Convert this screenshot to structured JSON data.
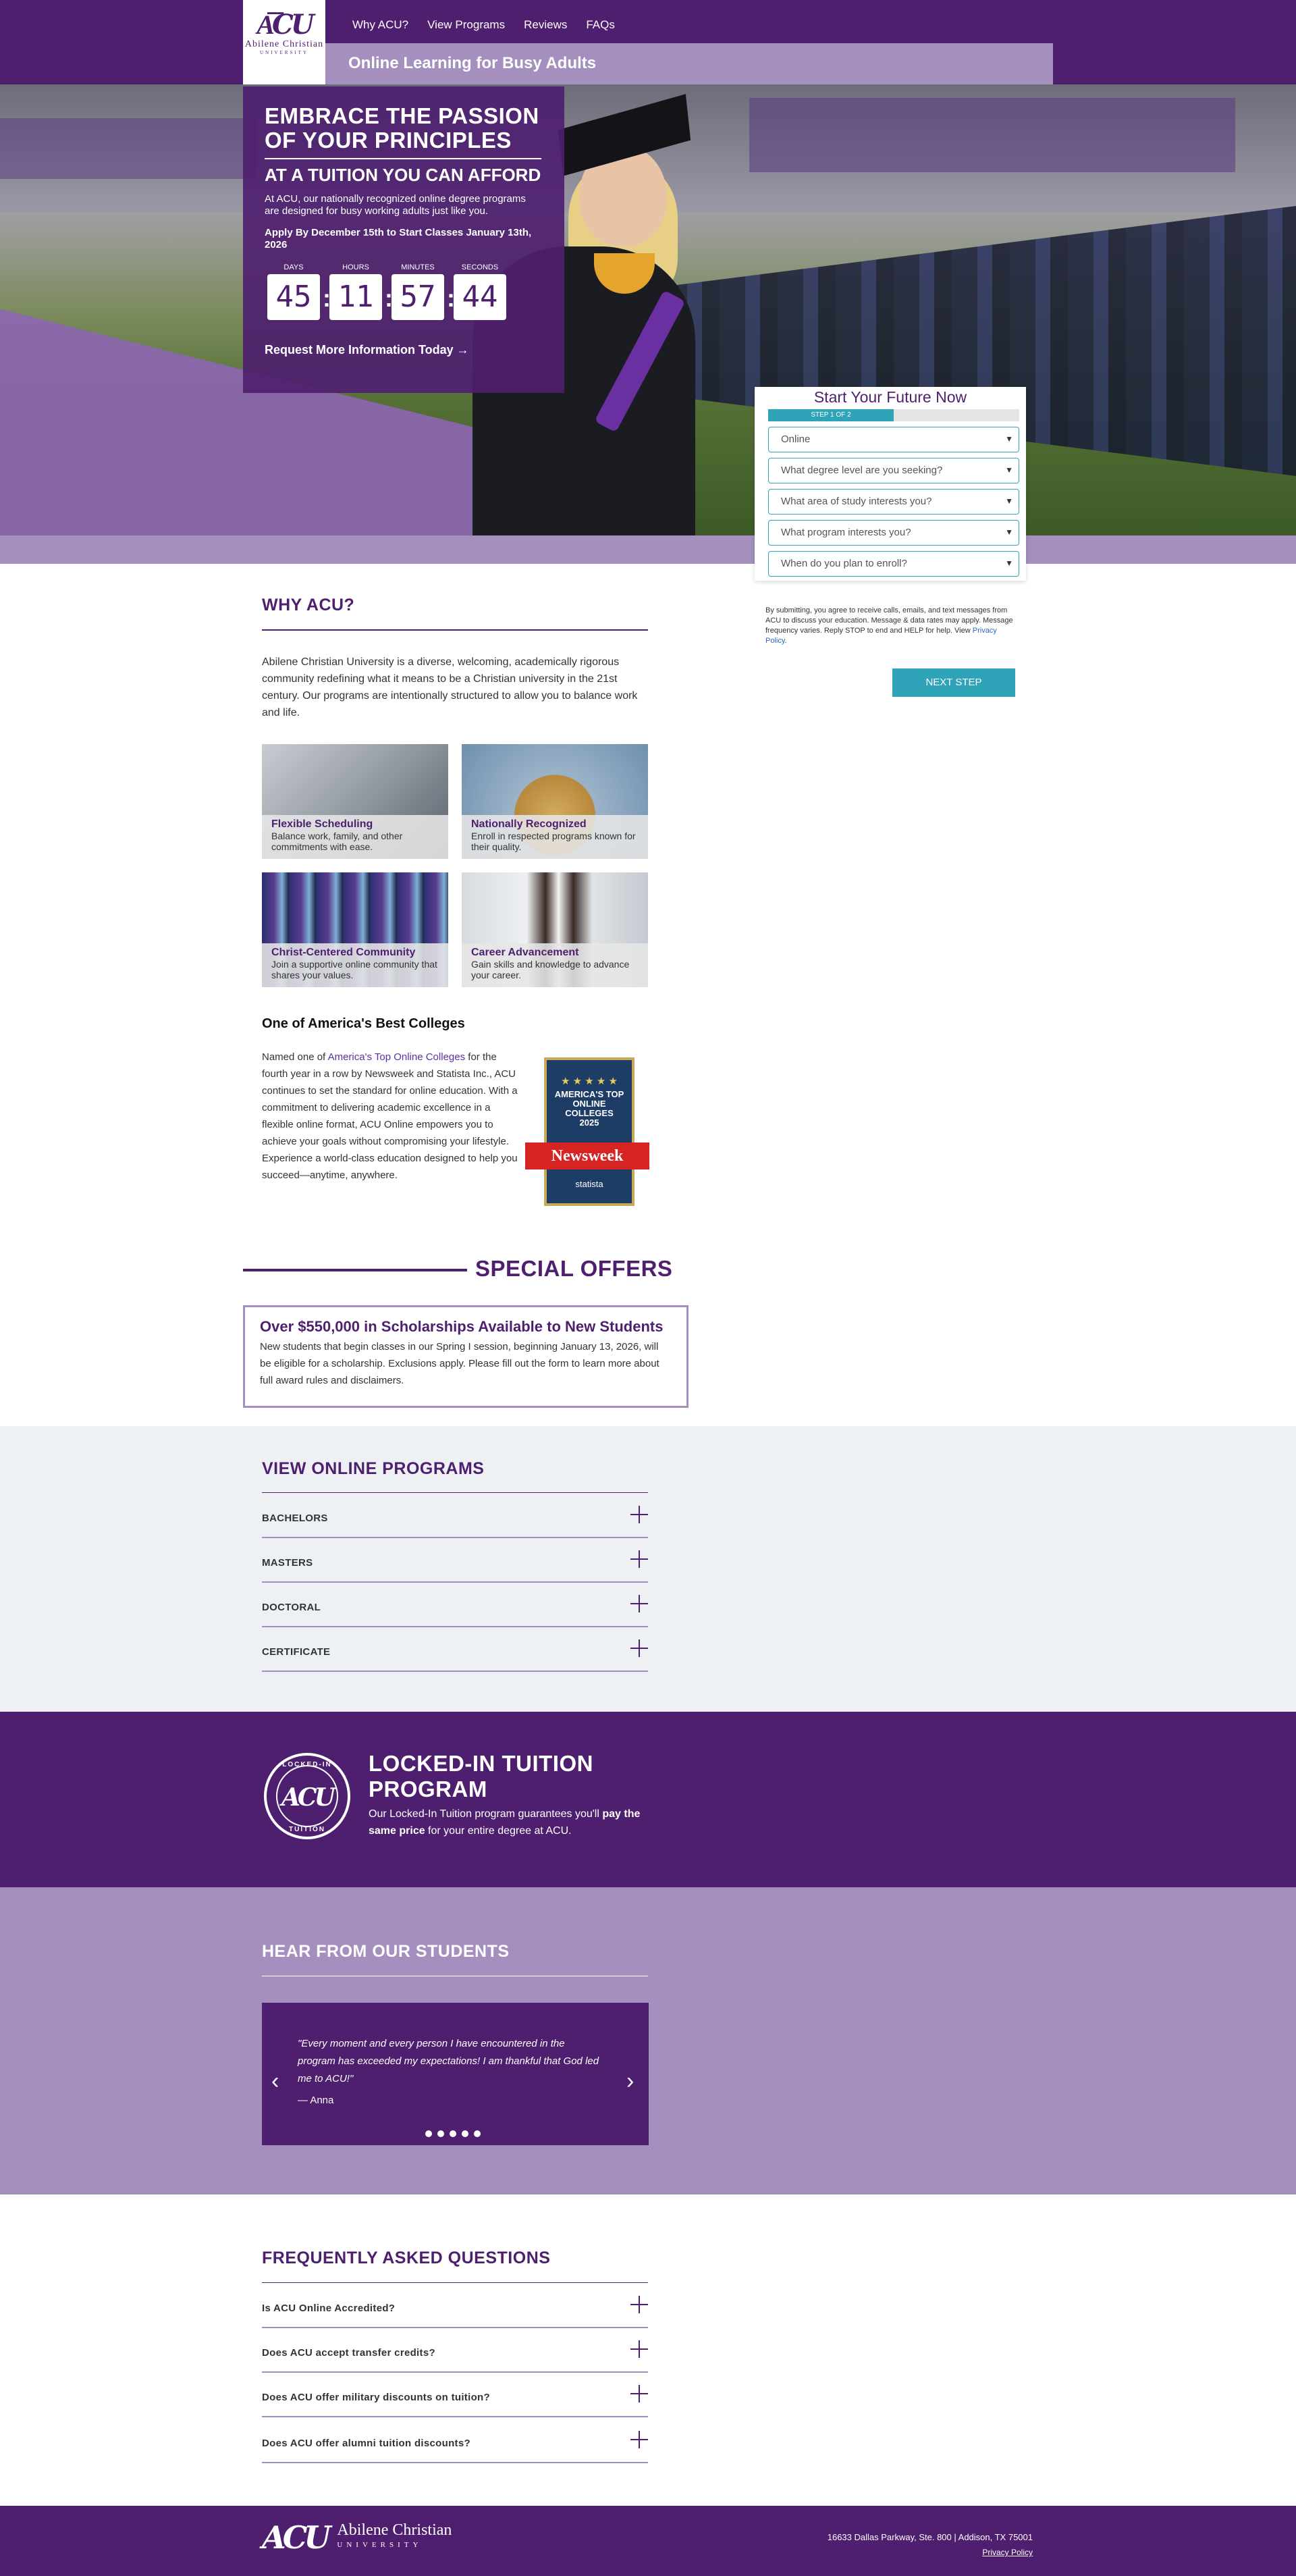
{
  "header": {
    "logo_mark": "A͞CU",
    "logo_line1": "Abilene Christian",
    "logo_line2": "UNIVERSITY",
    "nav": [
      "Why ACU?",
      "View Programs",
      "Reviews",
      "FAQs"
    ],
    "tagline": "Online Learning for Busy Adults"
  },
  "hero": {
    "headline_1": "EMBRACE THE PASSION",
    "headline_2": "OF YOUR PRINCIPLES",
    "subhead": "AT A TUITION YOU CAN AFFORD",
    "body": "At ACU, our nationally recognized online degree programs are designed for busy working adults just like you.",
    "apply": "Apply By December 15th to Start Classes January 13th, 2026",
    "countdown": {
      "days_label": "DAYS",
      "days": "45",
      "hours_label": "HOURS",
      "hours": "11",
      "minutes_label": "MINUTES",
      "minutes": "57",
      "seconds_label": "SECONDS",
      "seconds": "44"
    },
    "cta": "Request More Information Today →"
  },
  "form": {
    "title": "Start Your Future Now",
    "step": "STEP 1 OF 2",
    "step_progress": 0.5,
    "fields": [
      "Online",
      "What degree level are you seeking?",
      "What area of study interests you?",
      "What program interests you?",
      "When do you plan to enroll?"
    ],
    "consent": "By submitting, you agree to receive calls, emails, and text messages from ACU to discuss your education. Message & data rates may apply. Message frequency varies. Reply STOP to end and HELP for help. View ",
    "privacy_link": "Privacy Policy",
    "consent_end": ".",
    "next": "NEXT STEP"
  },
  "why": {
    "title": "WHY ACU?",
    "text": "Abilene Christian University is a diverse, welcoming, academically rigorous community redefining what it means to be a Christian university in the 21st century. Our programs are intentionally structured to allow you to balance work and life.",
    "tiles": [
      {
        "title": "Flexible Scheduling",
        "text": "Balance work, family, and other commitments with ease."
      },
      {
        "title": "Nationally Recognized",
        "text": "Enroll in respected programs known for their quality."
      },
      {
        "title": "Christ-Centered Community",
        "text": "Join a supportive online community that shares your values."
      },
      {
        "title": "Career Advancement",
        "text": "Gain skills and knowledge to advance your career."
      }
    ]
  },
  "best": {
    "title": "One of America's Best Colleges",
    "pre": "Named one of ",
    "link": "America's Top Online Colleges",
    "post": " for the fourth year in a row by Newsweek and Statista Inc., ACU continues to set the standard for online education. With a commitment to delivering academic excellence in a flexible online format, ACU Online empowers you to achieve your goals without compromising your lifestyle. Experience a world-class education designed to help you succeed—anytime, anywhere.",
    "badge_stars": "★ ★ ★ ★ ★",
    "badge_line1": "AMERICA'S TOP",
    "badge_line2": "ONLINE",
    "badge_line3": "COLLEGES",
    "badge_year": "2025",
    "badge_ribbon": "Newsweek",
    "badge_partner": "statista"
  },
  "offers": {
    "title": "SPECIAL OFFERS",
    "headline": "Over $550,000 in Scholarships Available to New Students",
    "text": "New students that begin classes in our Spring I session, beginning January 13, 2026, will be eligible for a scholarship. Exclusions apply. Please fill out the form to learn more about full award rules and disclaimers."
  },
  "programs": {
    "title": "VIEW ONLINE PROGRAMS",
    "items": [
      "BACHELORS",
      "MASTERS",
      "DOCTORAL",
      "CERTIFICATE"
    ]
  },
  "locked": {
    "badge_top": "LOCKED-IN",
    "badge_mark": "ACU",
    "badge_bottom": "TUITION",
    "title": "LOCKED-IN TUITION PROGRAM",
    "text_pre": "Our Locked-In Tuition program guarantees you'll ",
    "text_bold": "pay the same price",
    "text_post": " for your entire degree at ACU."
  },
  "students": {
    "title": "HEAR FROM OUR STUDENTS",
    "quote": "\"Every moment and every person I have encountered in the program has exceeded my expectations! I am thankful that God led me to ACU!\"",
    "author": "— Anna",
    "prev": "‹",
    "next": "›"
  },
  "faq": {
    "title": "FREQUENTLY ASKED QUESTIONS",
    "items": [
      "Is ACU Online Accredited?",
      "Does ACU accept transfer credits?",
      "Does ACU offer military discounts on tuition?",
      "Does ACU offer alumni tuition discounts?"
    ]
  },
  "footer": {
    "logo_mark": "ACU",
    "name": "Abilene Christian",
    "name_sub": "UNIVERSITY",
    "address": "16633 Dallas Parkway, Ste. 800 | Addison, TX 75001",
    "privacy": "Privacy Policy"
  }
}
